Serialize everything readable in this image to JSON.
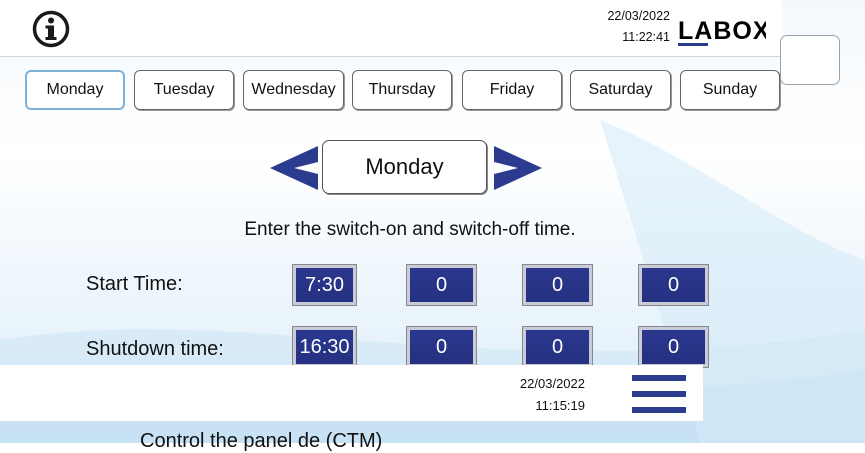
{
  "header": {
    "date": "22/03/2022",
    "time": "11:22:41",
    "logo": "LABOX",
    "info_icon": "info-icon"
  },
  "tabs": [
    {
      "label": "Monday",
      "active": true
    },
    {
      "label": "Tuesday"
    },
    {
      "label": "Wednesday"
    },
    {
      "label": "Thursday"
    },
    {
      "label": "Friday"
    },
    {
      "label": "Saturday"
    },
    {
      "label": "Sunday"
    }
  ],
  "day_selector": {
    "current": "Monday",
    "prev_icon": "chevron-left-icon",
    "next_icon": "chevron-right-icon"
  },
  "instruction": "Enter the switch-on and switch-off time.",
  "schedule": {
    "start_label": "Start Time:",
    "start_values": [
      "7:30",
      "0",
      "0",
      "0"
    ],
    "shutdown_label": "Shutdown time:",
    "shutdown_values": [
      "16:30",
      "0",
      "0",
      "0"
    ]
  },
  "footer": {
    "date": "22/03/2022",
    "time": "11:15:19",
    "menu_icon": "hamburger-menu-icon"
  },
  "caption": "Control the panel de (CTM)",
  "colors": {
    "brand": "#2b3b8e",
    "value_box": "#2a388f",
    "active_tab_border": "#7fb1d6"
  }
}
